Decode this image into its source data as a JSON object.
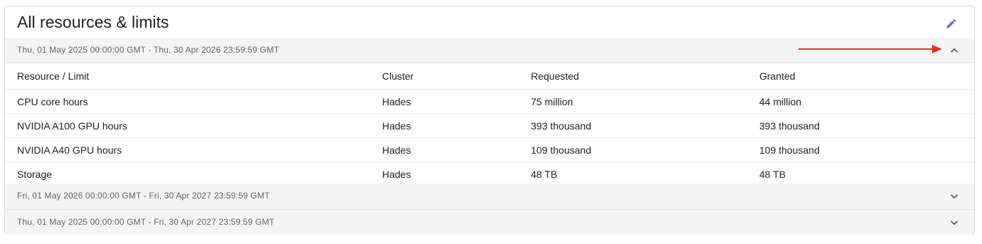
{
  "card": {
    "title": "All resources & limits",
    "edit_icon": "pencil-icon",
    "accent_color": "#7b68c9"
  },
  "periods": [
    {
      "label": "Thu, 01 May 2025 00:00:00 GMT - Thu, 30 Apr 2026 23:59:59 GMT",
      "expanded": true,
      "icon": "chevron-up-icon"
    },
    {
      "label": "Fri, 01 May 2026 00:00:00 GMT - Fri, 30 Apr 2027 23:59:59 GMT",
      "expanded": false,
      "icon": "chevron-down-icon"
    },
    {
      "label": "Thu, 01 May 2025 00:00:00 GMT - Fri, 30 Apr 2027 23:59:59 GMT",
      "expanded": false,
      "icon": "chevron-down-icon"
    }
  ],
  "table": {
    "headers": [
      "Resource / Limit",
      "Cluster",
      "Requested",
      "Granted"
    ],
    "rows": [
      [
        "CPU core hours",
        "Hades",
        "75 million",
        "44 million"
      ],
      [
        "NVIDIA A100 GPU hours",
        "Hades",
        "393 thousand",
        "393 thousand"
      ],
      [
        "NVIDIA A40 GPU hours",
        "Hades",
        "109 thousand",
        "109 thousand"
      ],
      [
        "Storage",
        "Hades",
        "48 TB",
        "48 TB"
      ]
    ]
  },
  "annotation": {
    "color": "#e8301c"
  }
}
